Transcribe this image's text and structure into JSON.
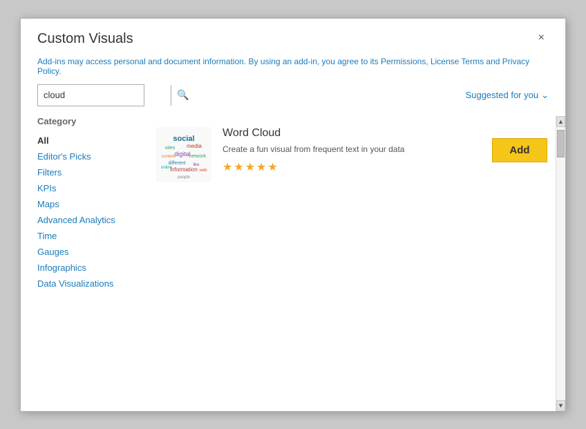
{
  "dialog": {
    "title": "Custom Visuals",
    "close_label": "×"
  },
  "info_bar": {
    "text": "Add-ins may access personal and document information. By using an add-in, you agree to its Permissions, License Terms and Privacy Policy."
  },
  "search": {
    "value": "cloud",
    "placeholder": "cloud",
    "icon": "🔍"
  },
  "suggested": {
    "label": "Suggested for you",
    "chevron": "∨"
  },
  "category": {
    "title": "Category",
    "items": [
      {
        "label": "All",
        "active": true
      },
      {
        "label": "Editor's Picks",
        "active": false
      },
      {
        "label": "Filters",
        "active": false
      },
      {
        "label": "KPIs",
        "active": false
      },
      {
        "label": "Maps",
        "active": false
      },
      {
        "label": "Advanced Analytics",
        "active": false
      },
      {
        "label": "Time",
        "active": false
      },
      {
        "label": "Gauges",
        "active": false
      },
      {
        "label": "Infographics",
        "active": false
      },
      {
        "label": "Data Visualizations",
        "active": false
      }
    ]
  },
  "visuals": [
    {
      "name": "Word Cloud",
      "description": "Create a fun visual from frequent text in your data",
      "stars": 5,
      "add_label": "Add"
    }
  ]
}
